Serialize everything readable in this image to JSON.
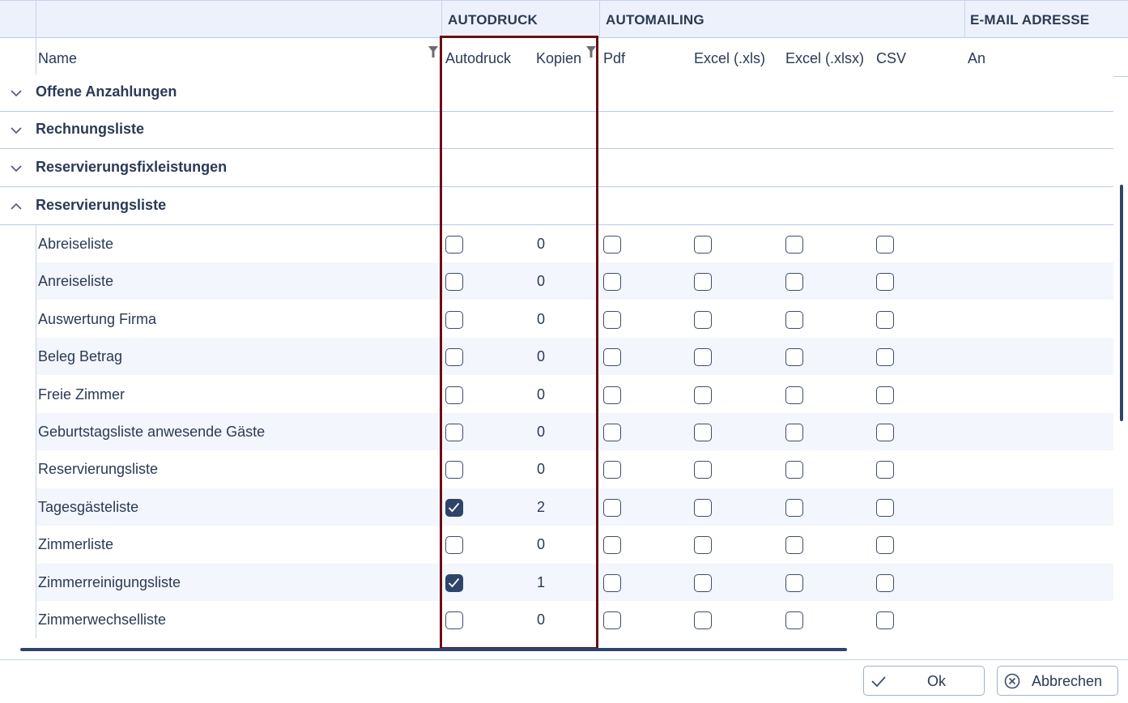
{
  "groups_header": {
    "autodruck": "AUTODRUCK",
    "automailing": "AUTOMAILING",
    "email_adresse": "E-MAIL ADRESSE"
  },
  "columns": {
    "name": "Name",
    "autodruck": "Autodruck",
    "kopien": "Kopien",
    "pdf": "Pdf",
    "excel_xls": "Excel (.xls)",
    "excel_xlsx": "Excel (.xlsx)",
    "csv": "CSV",
    "an": "An"
  },
  "icons": {
    "filter": "filter-icon",
    "collapsed": "chevron-down-icon",
    "expanded": "chevron-up-icon",
    "checkmark": "check-icon",
    "cancel": "close-circle-icon"
  },
  "collapsed_groups": [
    {
      "label": "Offene Anzahlungen"
    },
    {
      "label": "Rechnungsliste"
    },
    {
      "label": "Reservierungsfixleistungen"
    }
  ],
  "expanded_group": {
    "label": "Reservierungsliste",
    "rows": [
      {
        "name": "Abreiseliste",
        "autodruck": false,
        "kopien": "0",
        "pdf": false,
        "xls": false,
        "xlsx": false,
        "csv": false
      },
      {
        "name": "Anreiseliste",
        "autodruck": false,
        "kopien": "0",
        "pdf": false,
        "xls": false,
        "xlsx": false,
        "csv": false
      },
      {
        "name": "Auswertung Firma",
        "autodruck": false,
        "kopien": "0",
        "pdf": false,
        "xls": false,
        "xlsx": false,
        "csv": false
      },
      {
        "name": "Beleg Betrag",
        "autodruck": false,
        "kopien": "0",
        "pdf": false,
        "xls": false,
        "xlsx": false,
        "csv": false
      },
      {
        "name": "Freie Zimmer",
        "autodruck": false,
        "kopien": "0",
        "pdf": false,
        "xls": false,
        "xlsx": false,
        "csv": false
      },
      {
        "name": "Geburtstagsliste anwesende Gäste",
        "autodruck": false,
        "kopien": "0",
        "pdf": false,
        "xls": false,
        "xlsx": false,
        "csv": false
      },
      {
        "name": "Reservierungsliste",
        "autodruck": false,
        "kopien": "0",
        "pdf": false,
        "xls": false,
        "xlsx": false,
        "csv": false
      },
      {
        "name": "Tagesgästeliste",
        "autodruck": true,
        "kopien": "2",
        "pdf": false,
        "xls": false,
        "xlsx": false,
        "csv": false
      },
      {
        "name": "Zimmerliste",
        "autodruck": false,
        "kopien": "0",
        "pdf": false,
        "xls": false,
        "xlsx": false,
        "csv": false
      },
      {
        "name": "Zimmerreinigungsliste",
        "autodruck": true,
        "kopien": "1",
        "pdf": false,
        "xls": false,
        "xlsx": false,
        "csv": false
      },
      {
        "name": "Zimmerwechselliste",
        "autodruck": false,
        "kopien": "0",
        "pdf": false,
        "xls": false,
        "xlsx": false,
        "csv": false
      }
    ]
  },
  "footer": {
    "ok_label": "Ok",
    "cancel_label": "Abbrechen"
  },
  "colors": {
    "accent": "#2f4469",
    "highlight_border": "#6b0f15",
    "header_bg": "#edf1fb",
    "row_alt_bg": "#f3f6fc",
    "grid_line": "#b9cbe8"
  }
}
